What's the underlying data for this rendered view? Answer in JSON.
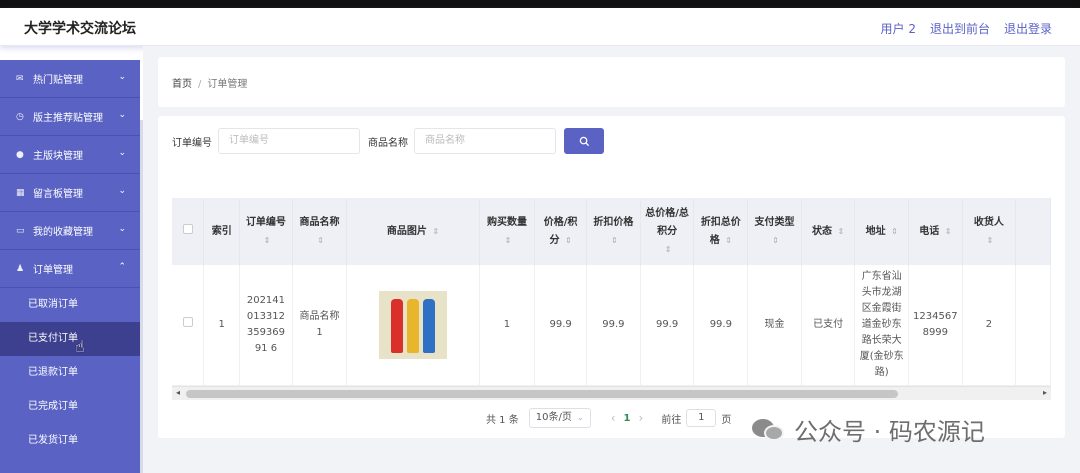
{
  "header": {
    "brand": "大学学术交流论坛",
    "user": "用户 2",
    "to_front": "退出到前台",
    "logout": "退出登录"
  },
  "sidebar": {
    "groups": [
      {
        "label": "热门贴管理",
        "icon": "mail-icon"
      },
      {
        "label": "版主推荐贴管理",
        "icon": "clock-icon"
      },
      {
        "label": "主版块管理",
        "icon": "pin-icon"
      },
      {
        "label": "留言板管理",
        "icon": "keyboard-icon"
      },
      {
        "label": "我的收藏管理",
        "icon": "message-icon"
      },
      {
        "label": "订单管理",
        "icon": "user-icon"
      }
    ],
    "sub_items": [
      {
        "label": "已取消订单"
      },
      {
        "label": "已支付订单"
      },
      {
        "label": "已退款订单"
      },
      {
        "label": "已完成订单"
      },
      {
        "label": "已发货订单"
      }
    ]
  },
  "breadcrumb": {
    "home": "首页",
    "sep": "/",
    "current": "订单管理"
  },
  "search": {
    "order_label": "订单编号",
    "order_placeholder": "订单编号",
    "product_label": "商品名称",
    "product_placeholder": "商品名称"
  },
  "table": {
    "headers": [
      "索引",
      "订单编号",
      "商品名称",
      "商品图片",
      "购买数量",
      "价格/积分",
      "折扣价格",
      "总价格/总积分",
      "折扣总价格",
      "支付类型",
      "状态",
      "地址",
      "电话",
      "收货人"
    ],
    "row": {
      "index": "1",
      "order_no": "20214101331235936991 6",
      "product": "商品名称1",
      "qty": "1",
      "price": "99.9",
      "discount": "99.9",
      "total": "99.9",
      "discount_total": "99.9",
      "pay_type": "现金",
      "status": "已支付",
      "address": "广东省汕头市龙湖区金霞街道金砂东路长荣大厦(金砂东路)",
      "phone": "12345678999",
      "receiver": "2"
    }
  },
  "pager": {
    "total": "共 1 条",
    "page_size": "10条/页",
    "current_page": "1",
    "goto_prefix": "前往",
    "goto_value": "1",
    "goto_suffix": "页"
  },
  "watermark": "公众号 · 码农源记"
}
